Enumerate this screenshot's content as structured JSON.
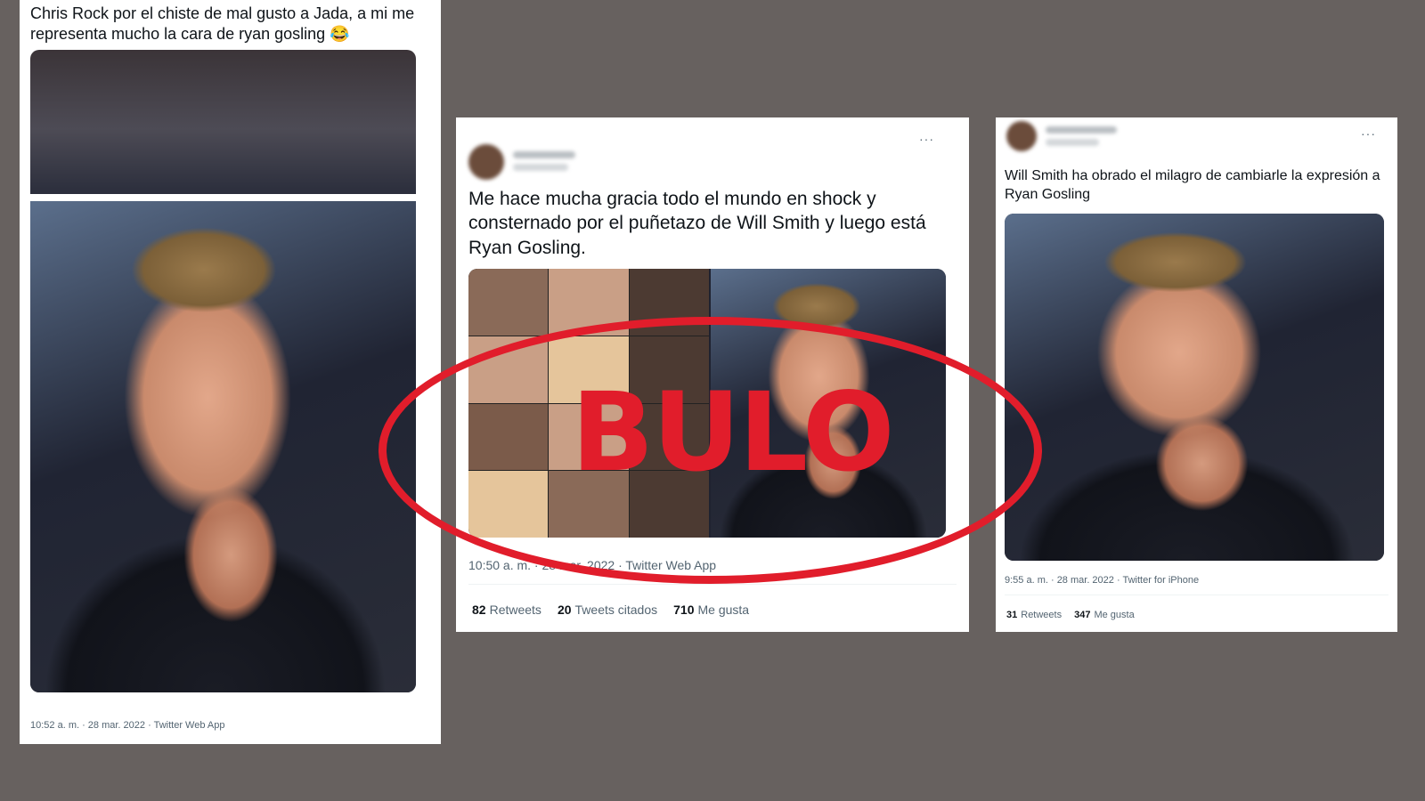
{
  "tweet1": {
    "text": "Chris Rock por el chiste de mal gusto a Jada, a mi me representa mucho la cara de ryan gosling 😂",
    "meta": "10:52 a. m. · 28 mar. 2022 · Twitter Web App"
  },
  "tweet2": {
    "text": "Me hace mucha gracia todo el mundo en shock y consternado por el puñetazo de Will Smith y luego está Ryan Gosling.",
    "meta": "10:50 a. m. · 28 mar. 2022 · Twitter Web App",
    "more": "···",
    "stats": {
      "retweets_count": "82",
      "retweets_label": "Retweets",
      "quotes_count": "20",
      "quotes_label": "Tweets citados",
      "likes_count": "710",
      "likes_label": "Me gusta"
    }
  },
  "tweet3": {
    "text": "Will Smith ha obrado el milagro de cambiarle la expresión a Ryan Gosling",
    "meta": "9:55 a. m. · 28 mar. 2022 · Twitter for iPhone",
    "more": "···",
    "stats": {
      "retweets_count": "31",
      "retweets_label": "Retweets",
      "likes_count": "347",
      "likes_label": "Me gusta"
    }
  },
  "stamp": {
    "label": "BULO",
    "color": "#e11d2b"
  }
}
